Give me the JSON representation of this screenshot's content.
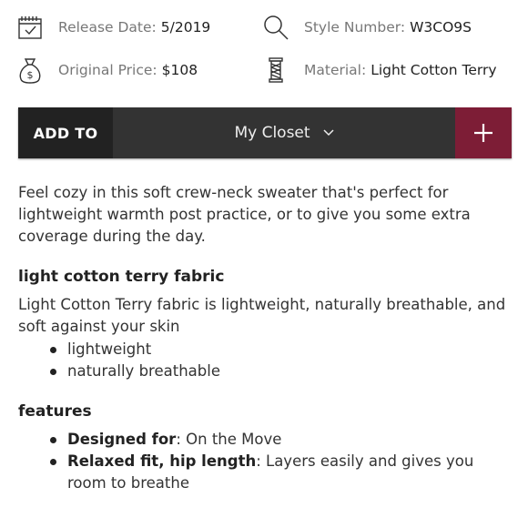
{
  "meta": {
    "release": {
      "label": "Release Date:",
      "value": "5/2019",
      "icon": "calendar-icon"
    },
    "style": {
      "label": "Style Number:",
      "value": "W3CO9S",
      "icon": "search-icon"
    },
    "price": {
      "label": "Original Price:",
      "value": "$108",
      "icon": "money-bag-icon"
    },
    "material": {
      "label": "Material:",
      "value": "Light Cotton Terry",
      "icon": "yarn-spool-icon"
    }
  },
  "add_bar": {
    "add_to_label": "ADD TO",
    "closet_value": "My Closet",
    "plus_label": "+"
  },
  "description": "Feel cozy in this soft crew-neck sweater that's perfect for lightweight warmth post practice, or to give you some extra coverage during the day.",
  "fabric": {
    "heading": "light cotton terry fabric",
    "text": "Light Cotton Terry fabric is lightweight, naturally breathable, and soft against your skin",
    "bullets": [
      "lightweight",
      "naturally breathable"
    ]
  },
  "features": {
    "heading": "features",
    "items": [
      {
        "title": "Designed for",
        "text": ": On the Move"
      },
      {
        "title": "Relaxed fit, hip length",
        "text": ": Layers easily and gives you room to breathe"
      }
    ]
  },
  "colors": {
    "accent": "#7d1d36",
    "bar": "#333333",
    "bar_dark": "#222222"
  }
}
